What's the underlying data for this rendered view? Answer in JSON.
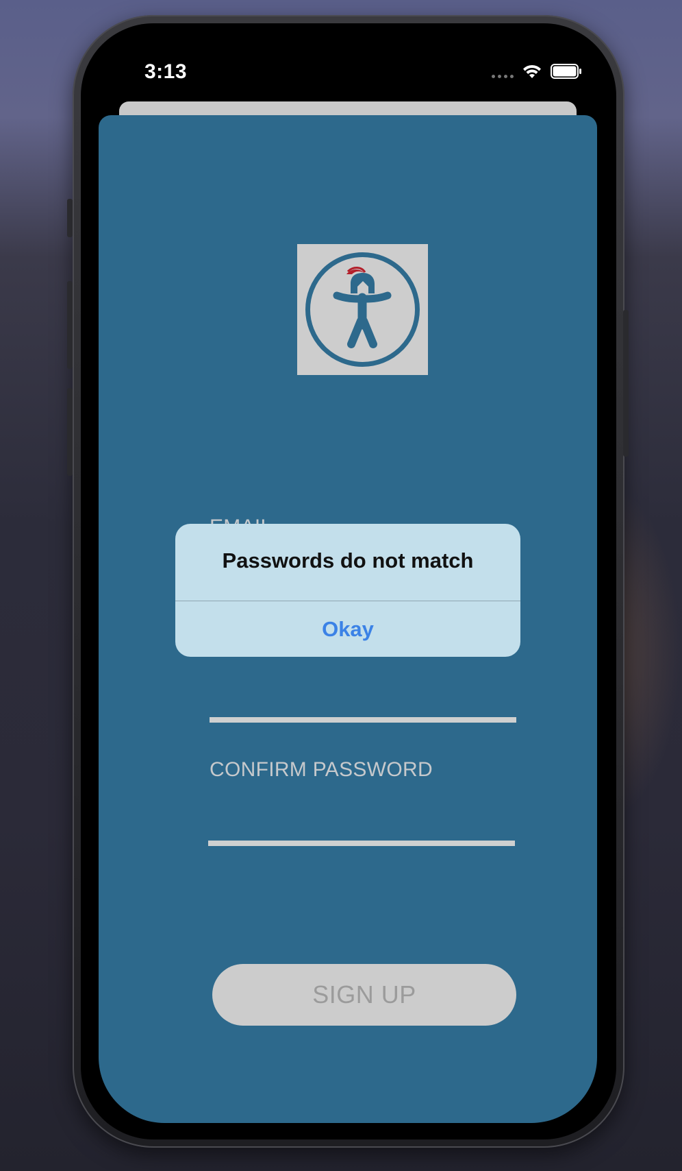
{
  "status_bar": {
    "time": "3:13"
  },
  "colors": {
    "card_background": "#2d698c",
    "alert_background": "#c3dfeb",
    "alert_button_text": "#3b82e6",
    "signup_button_background": "#cccccc",
    "logo_background": "#cdcdcd",
    "logo_accent": "#2d698c",
    "plume": "#b3202b"
  },
  "logo": {
    "icon": "accessibility-warrior-icon"
  },
  "form": {
    "email_label": "EMAIL",
    "confirm_password_label": "CONFIRM PASSWORD",
    "signup_label": "SIGN UP"
  },
  "alert": {
    "title": "Passwords do not match",
    "button_label": "Okay"
  }
}
